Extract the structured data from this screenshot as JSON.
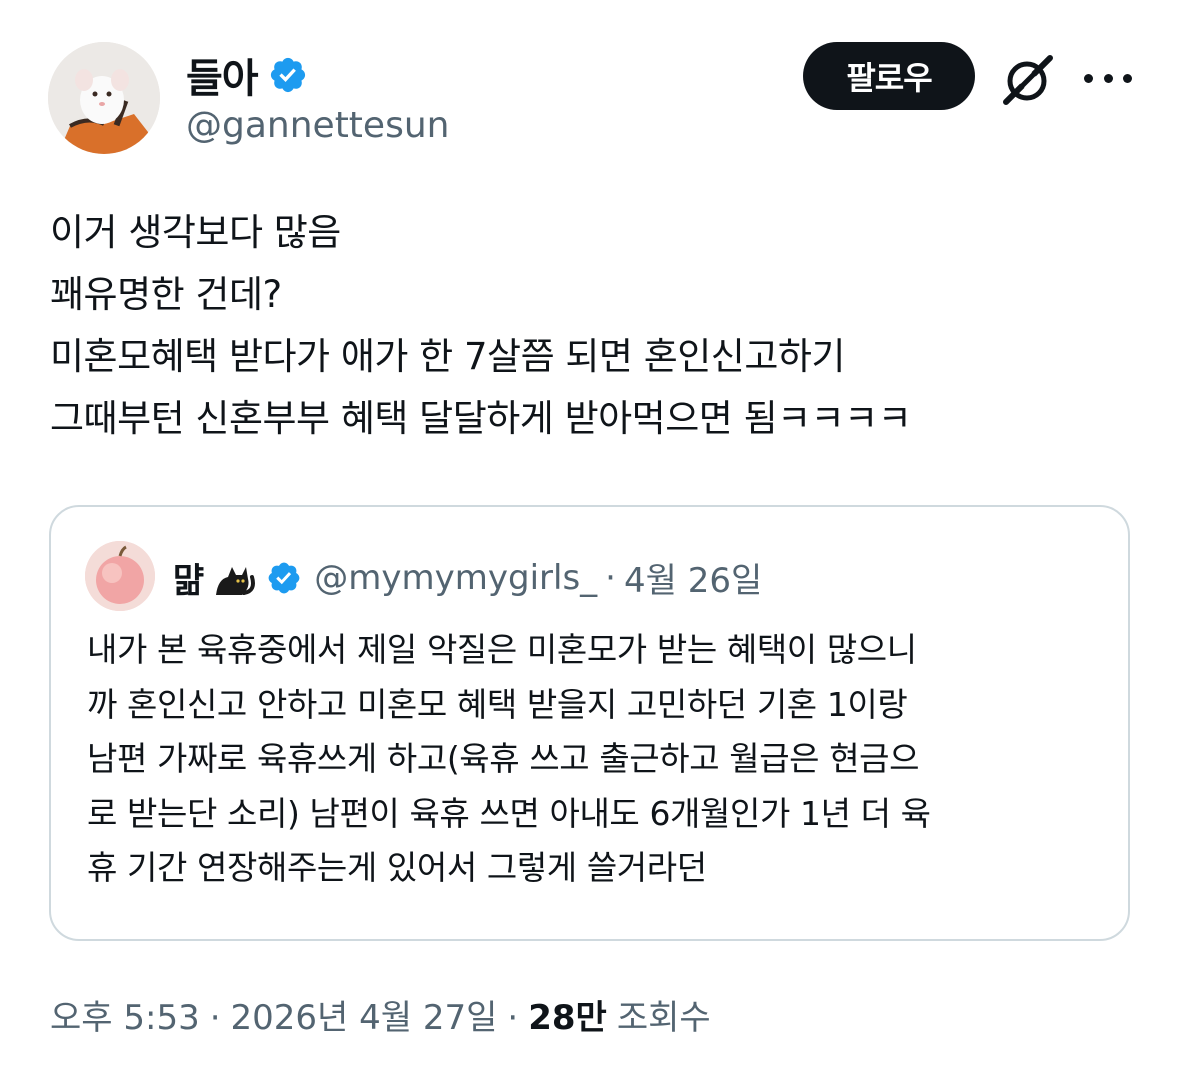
{
  "author": {
    "display_name": "들아",
    "handle": "@gannettesun",
    "verified": true,
    "avatar_icon": "white-rat-avatar"
  },
  "actions": {
    "follow_label": "팔로우",
    "grok_icon": "grok-icon",
    "more_icon": "more-dots-icon"
  },
  "tweet": {
    "lines": [
      "이거 생각보다 많음",
      "꽤유명한 건데?",
      "미혼모혜택 받다가 애가 한 7살쯤 되면 혼인신고하기",
      "그때부턴 신혼부부 혜택 달달하게 받아먹으면 됨ㅋㅋㅋㅋ"
    ]
  },
  "quote": {
    "display_name": "먊",
    "name_emoji": "black-cat-icon",
    "verified": true,
    "handle": "@mymymygirls_",
    "separator": "·",
    "date": "4월 26일",
    "avatar_icon": "peach-avatar",
    "lines": [
      "내가 본 육휴중에서 제일 악질은 미혼모가 받는 혜택이 많으니",
      "까 혼인신고 안하고 미혼모 혜택 받을지 고민하던 기혼 1이랑",
      "남편 가짜로 육휴쓰게 하고(육휴 쓰고 출근하고 월급은 현금으",
      "로 받는단 소리) 남편이 육휴 쓰면 아내도 6개월인가 1년 더 육",
      "휴 기간 연장해주는게 있어서 그렇게 쓸거라던"
    ]
  },
  "footer": {
    "time": "오후 5:53",
    "separator": "·",
    "date": "2026년 4월 27일",
    "views_count": "28만",
    "views_label": "조회수"
  },
  "colors": {
    "text": "#0f1419",
    "secondary": "#536471",
    "verified_blue": "#1d9bf0",
    "border": "#cfd9de",
    "button_bg": "#0f1419"
  }
}
